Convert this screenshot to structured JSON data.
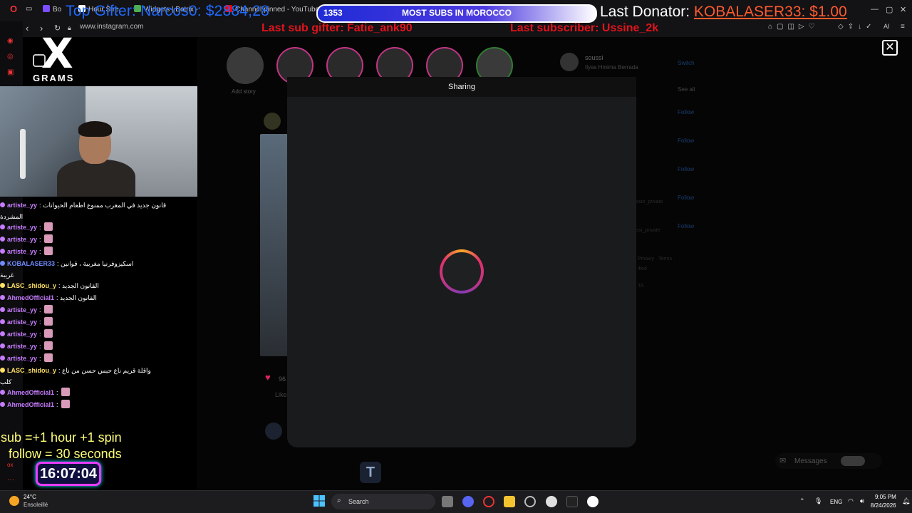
{
  "browser": {
    "tabs": [
      {
        "label": "Bo",
        "color": "#7c4dff"
      },
      {
        "label": "Hour Stre",
        "color": "#ffffff"
      },
      {
        "label": "Widgets | Botrix -",
        "color": "#4caf50"
      },
      {
        "label": "Channel pinned - YouTube",
        "color": "#ff0000"
      }
    ],
    "url": "www.instagram.com",
    "ai_label": "AI"
  },
  "overlays": {
    "top_gifter": "Top Gifter: Narcos0: $2884,28",
    "subs_count": "1353",
    "subs_title": "MOST SUBS IN MOROCCO",
    "last_donator_label": "Last Donator:",
    "last_donator_value": "KOBALASER33: $1.00",
    "last_sub_gifter": "Last sub gifter: Fatie_ank90",
    "last_subscriber": "Last subscriber: Ussine_2k",
    "sub_rule": "sub  =+1 hour +1 spin",
    "follow_rule": "follow = 30 seconds",
    "timer": "16:07:04"
  },
  "logo": {
    "mark": "X",
    "text": "GRAMS"
  },
  "instagram": {
    "add_story_label": "Add story",
    "profile_handle": "soussi",
    "profile_name": "Ilyas Hmima Berrada",
    "switch_label": "Switch",
    "see_all_label": "See all",
    "follow_label": "Follow",
    "likes_count": "96",
    "liked_label": "Like",
    "footer_fragments": [
      "ssio_private",
      "ssi_private",
      "Privacy · Terms ·",
      "ified",
      "TA"
    ],
    "messages_label": "Messages"
  },
  "modal": {
    "title": "Sharing",
    "close_symbol": "✕"
  },
  "chat": [
    {
      "user": "artiste_yy",
      "color": "#c77dff",
      "msg": ": قانون جديد في المغرب ممنوع اطعام الحيوانات",
      "cont": "المشردة"
    },
    {
      "user": "artiste_yy",
      "color": "#c77dff",
      "msg": ":",
      "emote": true
    },
    {
      "user": "artiste_yy",
      "color": "#c77dff",
      "msg": ":",
      "emote": true
    },
    {
      "user": "artiste_yy",
      "color": "#c77dff",
      "msg": ":",
      "emote": true
    },
    {
      "user": "KOBALASER33",
      "color": "#6f8bff",
      "msg": ": اسكيزوفرنيا مغربية ، قوانين",
      "cont": "غريبة"
    },
    {
      "user": "LASC_shidou_y",
      "color": "#ffe066",
      "msg": ": القانون الجديد"
    },
    {
      "user": "AhmedOfficial1",
      "color": "#c77dff",
      "msg": ": القانون الجديد"
    },
    {
      "user": "artiste_yy",
      "color": "#c77dff",
      "msg": ":",
      "emote": true
    },
    {
      "user": "artiste_yy",
      "color": "#c77dff",
      "msg": ":",
      "emote": true
    },
    {
      "user": "artiste_yy",
      "color": "#c77dff",
      "msg": ":",
      "emote": true
    },
    {
      "user": "artiste_yy",
      "color": "#c77dff",
      "msg": ":",
      "emote": true
    },
    {
      "user": "artiste_yy",
      "color": "#c77dff",
      "msg": ":",
      "emote": true
    },
    {
      "user": "LASC_shidou_y",
      "color": "#ffe066",
      "msg": ": واقلة قريم ناع حبس حسن من ناع",
      "cont": "كلب"
    },
    {
      "user": "AhmedOfficial1",
      "color": "#c77dff",
      "msg": ":",
      "emote": true
    },
    {
      "user": "AhmedOfficial1",
      "color": "#c77dff",
      "msg": ":",
      "emote": true
    }
  ],
  "taskbar": {
    "temp": "24°C",
    "weather": "Ensoleillé",
    "search_placeholder": "Search",
    "lang": "ENG",
    "time": "9:05 PM",
    "date": "8/24/2026",
    "icons": [
      "task-view-icon",
      "discord-icon",
      "opera-icon",
      "file-explorer-icon",
      "settings-icon",
      "obs-icon",
      "terminal-icon",
      "media-player-icon"
    ]
  }
}
